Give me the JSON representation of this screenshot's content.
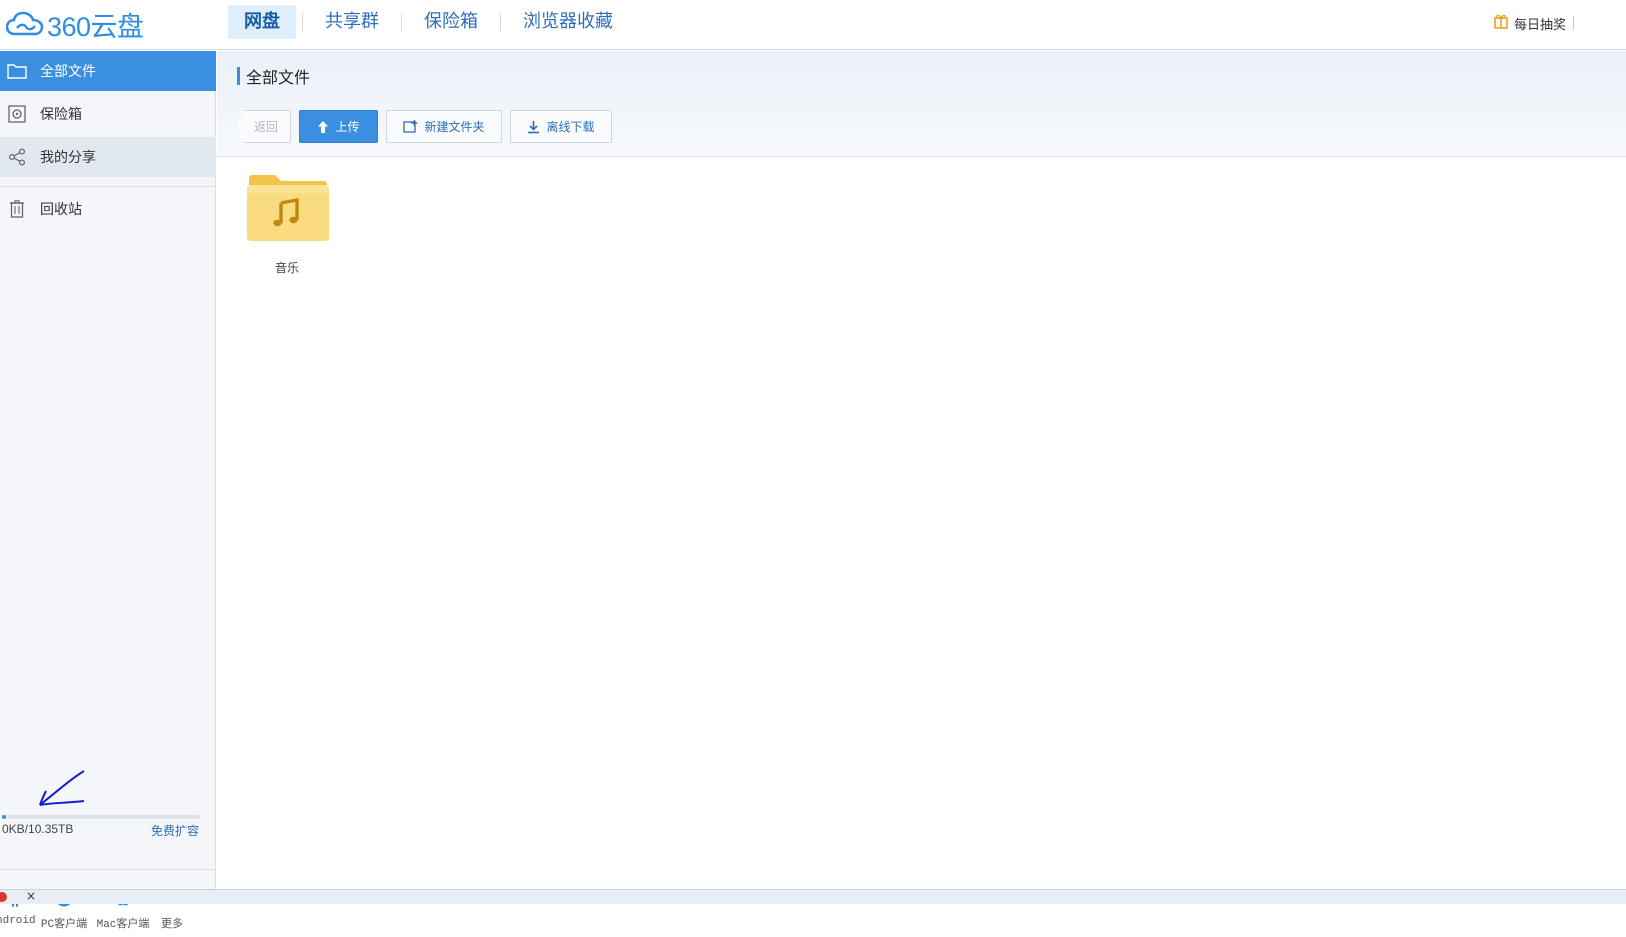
{
  "app": {
    "logo_text": "360云盘",
    "brand_color": "#2f8ee0"
  },
  "nav": {
    "items": [
      {
        "label": "网盘",
        "active": true
      },
      {
        "label": "共享群",
        "active": false
      },
      {
        "label": "保险箱",
        "active": false
      },
      {
        "label": "浏览器收藏",
        "active": false
      }
    ],
    "daily_lottery": "每日抽奖"
  },
  "sidebar": {
    "items": [
      {
        "label": "全部文件",
        "icon": "folder-icon",
        "state": "active"
      },
      {
        "label": "保险箱",
        "icon": "safe-icon",
        "state": "normal"
      },
      {
        "label": "我的分享",
        "icon": "share-icon",
        "state": "hover"
      },
      {
        "label": "回收站",
        "icon": "trash-icon",
        "state": "normal"
      }
    ],
    "storage": {
      "usage_text": "0KB/10.35TB",
      "used_fraction": 0.0,
      "expand_label": "免费扩容"
    },
    "clients": [
      {
        "label": "ndroid",
        "icon": "android-icon"
      },
      {
        "label": "PC客户端",
        "icon": "windows-icon"
      },
      {
        "label": "Mac客户端",
        "icon": "apple-icon"
      },
      {
        "label": "更多",
        "icon": "more-icon"
      }
    ]
  },
  "main": {
    "breadcrumb": "全部文件",
    "toolbar": {
      "back_label": "返回",
      "upload_label": "上传",
      "new_folder_label": "新建文件夹",
      "offline_download_label": "离线下载"
    },
    "files": [
      {
        "name": "音乐",
        "type": "folder",
        "icon": "music-folder-icon"
      }
    ]
  },
  "statusbar": {
    "close_label": "×"
  },
  "colors": {
    "accent": "#3a8fe0",
    "link": "#2c6fb8",
    "folder": "#f7d56a"
  }
}
